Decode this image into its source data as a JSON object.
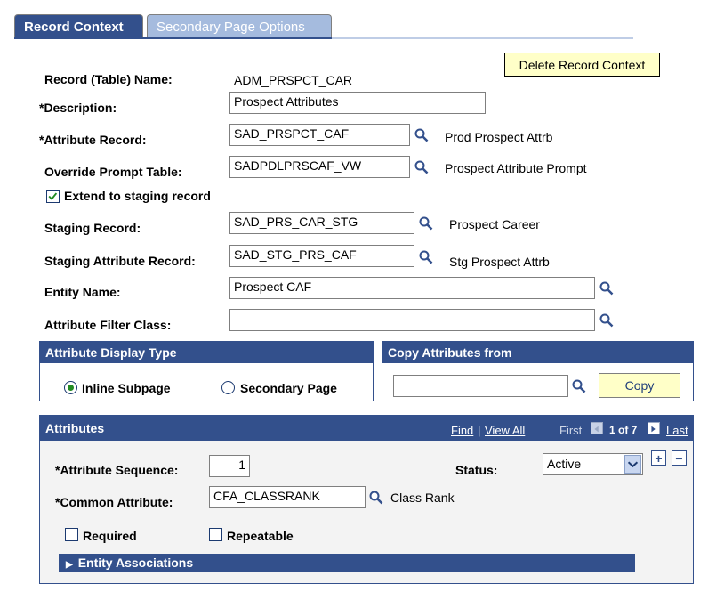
{
  "tabs": [
    {
      "label": "Record Context",
      "active": true
    },
    {
      "label": "Secondary Page Options",
      "active": false
    }
  ],
  "delete_button": "Delete Record Context",
  "fields": {
    "record_table_name": {
      "label": "Record (Table) Name:",
      "value": "ADM_PRSPCT_CAR"
    },
    "description": {
      "label": "*Description:",
      "value": "Prospect Attributes"
    },
    "attribute_record": {
      "label": "*Attribute Record:",
      "value": "SAD_PRSPCT_CAF",
      "desc": "Prod Prospect Attrb"
    },
    "override_prompt_table": {
      "label": "Override Prompt Table:",
      "value": "SADPDLPRSCAF_VW",
      "desc": "Prospect Attribute Prompt"
    },
    "extend_staging": {
      "label": "Extend to staging record",
      "checked": true
    },
    "staging_record": {
      "label": "Staging Record:",
      "value": "SAD_PRS_CAR_STG",
      "desc": "Prospect Career"
    },
    "staging_attribute_record": {
      "label": "Staging Attribute Record:",
      "value": "SAD_STG_PRS_CAF",
      "desc": "Stg Prospect Attrb"
    },
    "entity_name": {
      "label": "Entity Name:",
      "value": "Prospect CAF"
    },
    "attribute_filter_class": {
      "label": "Attribute Filter Class:",
      "value": ""
    }
  },
  "display_type": {
    "title": "Attribute Display Type",
    "options": [
      "Inline Subpage",
      "Secondary Page"
    ],
    "selected": "Inline Subpage"
  },
  "copy_attributes": {
    "title": "Copy Attributes from",
    "value": "",
    "button": "Copy"
  },
  "attributes": {
    "title": "Attributes",
    "find": "Find",
    "sep": "|",
    "view_all": "View All",
    "first": "First",
    "position": "1 of 7",
    "last": "Last",
    "sequence_label": "*Attribute Sequence:",
    "sequence_value": "1",
    "status_label": "Status:",
    "status_value": "Active",
    "common_label": "*Common Attribute:",
    "common_value": "CFA_CLASSRANK",
    "common_desc": "Class Rank",
    "required_label": "Required",
    "repeatable_label": "Repeatable",
    "add": "+",
    "remove": "−",
    "entity_assoc": "Entity Associations"
  },
  "colors": {
    "header_blue": "#33508c",
    "button_yellow": "#ffffc8",
    "radio_green": "#228b22"
  }
}
